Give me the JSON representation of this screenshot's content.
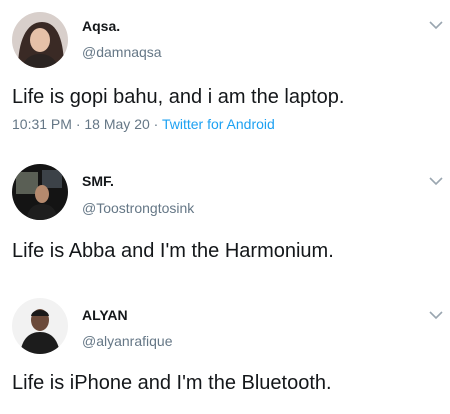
{
  "tweets": [
    {
      "name": "Aqsa.",
      "handle": "@damnaqsa",
      "text": "Life is gopi bahu, and i am the laptop.",
      "time": "10:31 PM",
      "sep1": " · ",
      "date": "18 May 20",
      "sep2": " · ",
      "source": "Twitter for Android"
    },
    {
      "name": "SMF.",
      "handle": "@Toostrongtosink",
      "text": "Life is Abba and I'm the Harmonium."
    },
    {
      "name": "ALYAN",
      "handle": "@alyanrafique",
      "text": "Life is iPhone and I'm the Bluetooth."
    }
  ],
  "icons": {
    "more": "chevron-down-icon",
    "avatar": "avatar"
  },
  "colors": {
    "text": "#14171a",
    "secondary": "#657786",
    "link": "#1da1f2"
  }
}
